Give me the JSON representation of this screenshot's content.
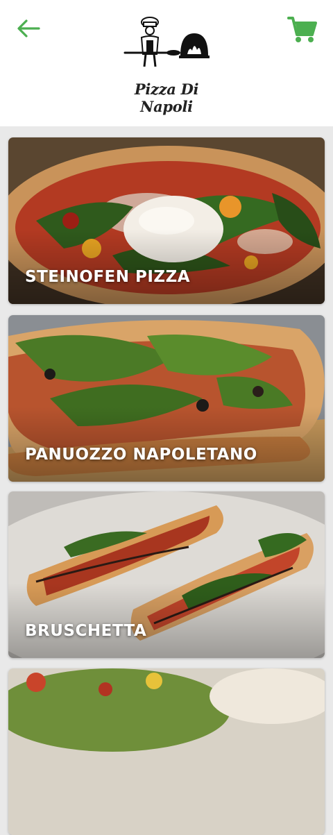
{
  "header": {
    "logo_text": "Pizza Di Napoli"
  },
  "theme": {
    "accent": "#4caf50",
    "background": "#e9e9e9"
  },
  "icons": {
    "back": "arrow-left-icon",
    "cart": "shopping-cart-icon"
  },
  "categories": [
    {
      "label": "STEINOFEN PIZZA"
    },
    {
      "label": "PANUOZZO NAPOLETANO"
    },
    {
      "label": "BRUSCHETTA"
    },
    {
      "label": ""
    }
  ]
}
